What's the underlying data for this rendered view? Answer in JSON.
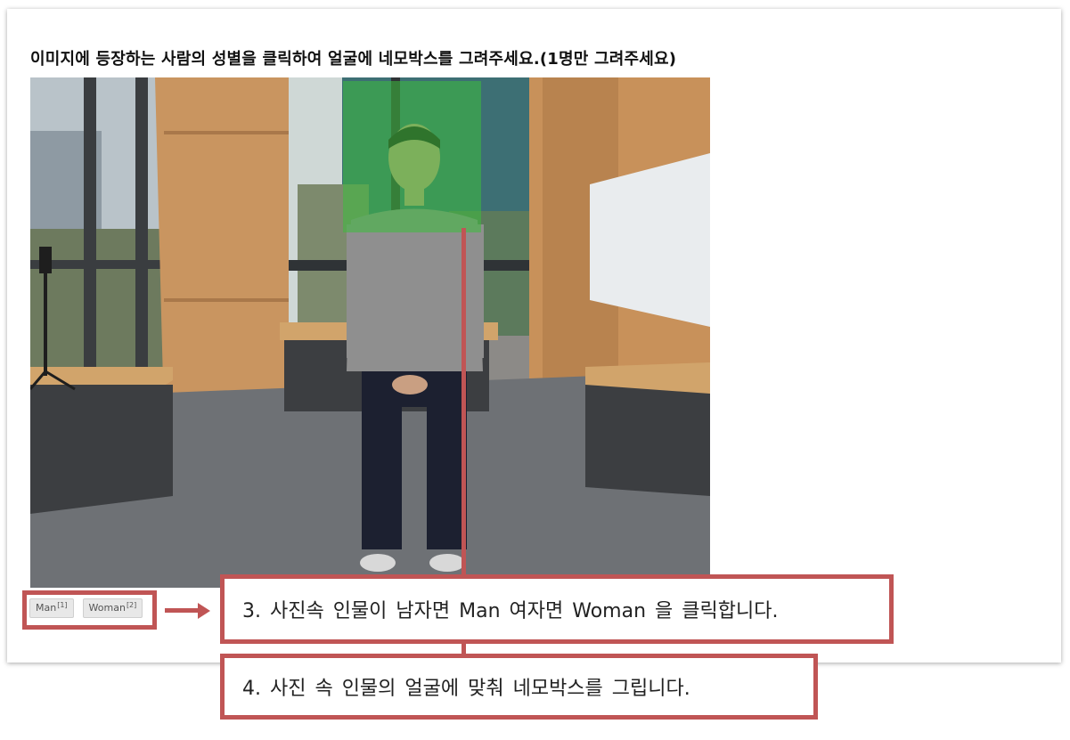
{
  "instruction": "이미지에 등장하는 사람의 성별을 클릭하여 얼굴에 네모박스를 그려주세요.(1명만 그려주세요)",
  "photo": {
    "face_box_color": "#3cbe3c"
  },
  "gender_buttons": [
    {
      "label": "Man",
      "shortcut": "[1]"
    },
    {
      "label": "Woman",
      "shortcut": "[2]"
    }
  ],
  "callouts": {
    "step3": "3. 사진속 인물이 남자면 Man 여자면 Woman 을 클릭합니다.",
    "step4": "4. 사진 속 인물의 얼굴에 맞춰 네모박스를 그립니다."
  },
  "colors": {
    "highlight": "#c05555",
    "face_box": "#3cbe3c"
  }
}
